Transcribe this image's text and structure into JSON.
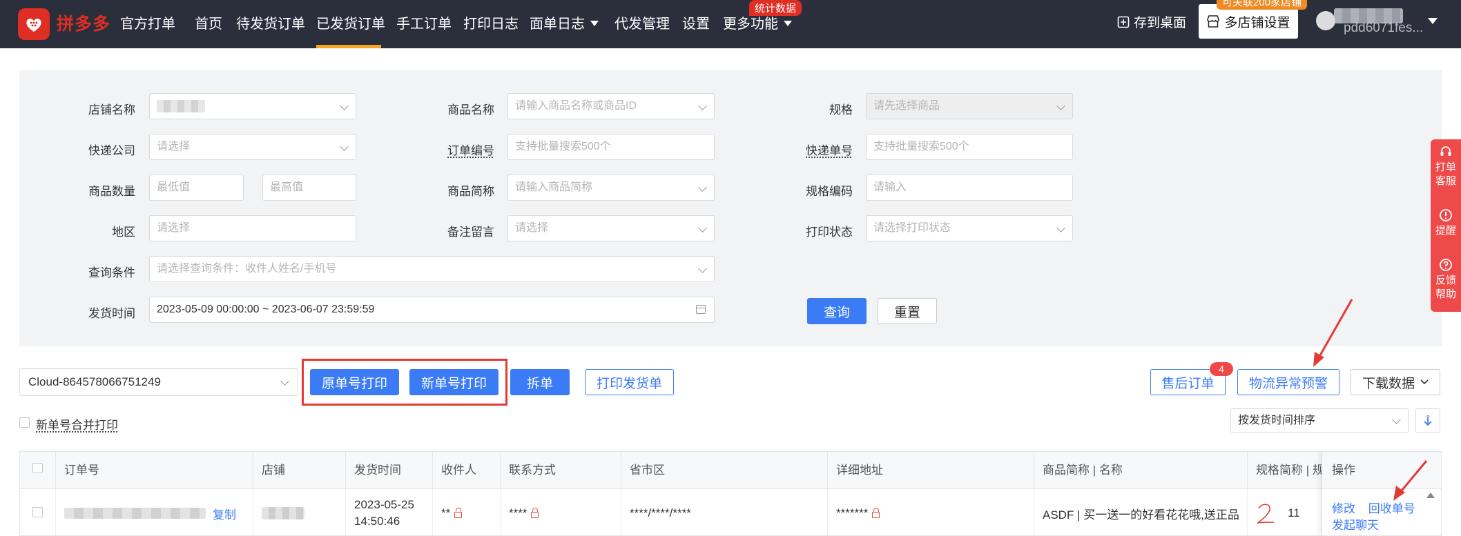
{
  "topbar": {
    "brand": "拼多多",
    "brand_sub": "官方打单",
    "nav": [
      "首页",
      "待发货订单",
      "已发货订单",
      "手工订单",
      "打印日志",
      "面单日志",
      "代发管理",
      "设置",
      "更多功能"
    ],
    "active_nav": "已发货订单",
    "stats_badge": "统计数据",
    "save_desktop": "存到桌面",
    "multi_shop": "多店铺设置",
    "multi_shop_badge": "可关联200家店铺",
    "user_name": "pdd6071fes..."
  },
  "filters": {
    "shop_name_label": "店铺名称",
    "product_name_label": "商品名称",
    "product_name_placeholder": "请输入商品名称或商品ID",
    "spec_label": "规格",
    "spec_placeholder": "请先选择商品",
    "courier_label": "快递公司",
    "courier_placeholder": "请选择",
    "order_no_label": "订单编号",
    "order_no_placeholder": "支持批量搜索500个",
    "tracking_label": "快递单号",
    "tracking_placeholder": "支持批量搜索500个",
    "qty_label": "商品数量",
    "qty_min_placeholder": "最低值",
    "qty_max_placeholder": "最高值",
    "short_name_label": "商品简称",
    "short_name_placeholder": "请输入商品简称",
    "spec_code_label": "规格编码",
    "spec_code_placeholder": "请输入",
    "region_label": "地区",
    "region_placeholder": "请选择",
    "remark_label": "备注留言",
    "remark_placeholder": "请选择",
    "print_status_label": "打印状态",
    "print_status_placeholder": "请选择打印状态",
    "query_cond_label": "查询条件",
    "query_cond_placeholder": "请选择查询条件：收件人姓名/手机号",
    "ship_time_label": "发货时间",
    "ship_time_value": "2023-05-09 00:00:00 ~ 2023-06-07 23:59:59",
    "query_btn": "查询",
    "reset_btn": "重置"
  },
  "actions": {
    "account": "Cloud-864578066751249",
    "orig_print": "原单号打印",
    "new_print": "新单号打印",
    "split": "拆单",
    "print_invoice": "打印发货单",
    "after_sale": "售后订单",
    "after_sale_count": "4",
    "logistics_alert": "物流异常预警",
    "download": "下载数据",
    "merge_print": "新单号合并打印",
    "sort": "按发货时间排序"
  },
  "table": {
    "headers": [
      "订单号",
      "店铺",
      "发货时间",
      "收件人",
      "联系方式",
      "省市区",
      "详细地址",
      "商品简称 | 名称",
      "规格简称 | 规",
      "操作"
    ],
    "row": {
      "copy": "复制",
      "ship_date": "2023-05-25",
      "ship_time": "14:50:46",
      "receiver": "**",
      "contact": "****",
      "region": "****/****/****",
      "address": "*******",
      "product": "ASDF | 买一送一的好看花花哦,送正品",
      "qty": "11",
      "op_edit": "修改",
      "op_recycle": "回收单号",
      "op_chat": "发起聊天"
    }
  },
  "side": {
    "service": [
      "打单",
      "客服"
    ],
    "remind": "提醒",
    "feedback": [
      "反馈",
      "帮助"
    ]
  },
  "colors": {
    "nav_bg": "#2b2e3b",
    "brand_red": "#e02e24",
    "primary": "#3b7bf6",
    "annotation_red": "#e53935"
  }
}
